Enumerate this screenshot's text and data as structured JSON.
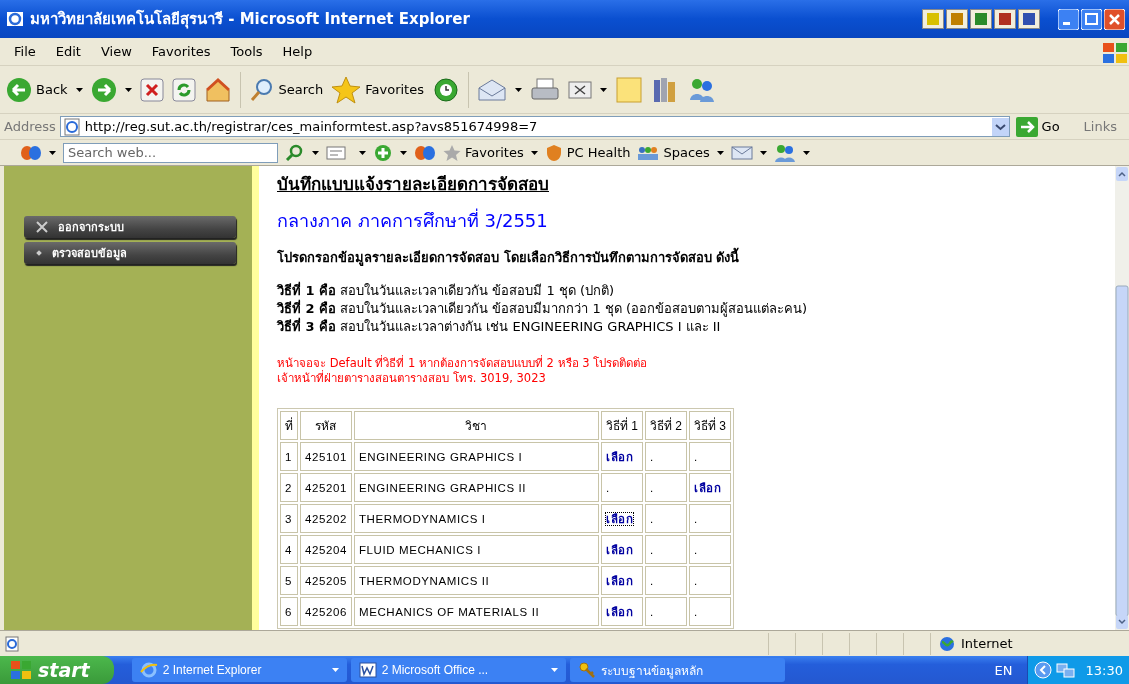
{
  "window": {
    "title": "มหาวิทยาลัยเทคโนโลยีสุรนารี - Microsoft Internet Explorer"
  },
  "menu": [
    "File",
    "Edit",
    "View",
    "Favorites",
    "Tools",
    "Help"
  ],
  "toolbar": {
    "back": "Back",
    "search": "Search",
    "favorites": "Favorites"
  },
  "address": {
    "label": "Address",
    "url": "http://reg.sut.ac.th/registrar/ces_mainformtest.asp?avs851674998=7",
    "go": "Go",
    "links": "Links"
  },
  "search_bar": {
    "placeholder": "Search web...",
    "favorites": "Favorites",
    "pc_health": "PC Health",
    "spaces": "Spaces"
  },
  "sidebar": {
    "items": [
      {
        "label": "ออกจากระบบ",
        "kind": "close"
      },
      {
        "label": "ตรวจสอบข้อมูล",
        "kind": "bullet"
      }
    ]
  },
  "page": {
    "heading": "บันทึกแบบแจ้งรายละเอียดการจัดสอบ",
    "term": "กลางภาค ภาคการศึกษาที่ 3/2551",
    "instruction": "โปรดกรอกข้อมูลรายละเอียดการจัดสอบ โดยเลือกวิธีการบันทึกตามการจัดสอบ ดังนี้",
    "methods": [
      "**วิธีที่ 1 คือ** สอบในวันและเวลาเดียวกัน ข้อสอบมี 1 ชุด (ปกติ)",
      "**วิธีที่ 2 คือ** สอบในวันและเวลาเดียวกัน ข้อสอบมีมากกว่า 1 ชุด (ออกข้อสอบตามผู้สอนแต่ละคน)",
      "**วิธีที่ 3 คือ** สอบในวันและเวลาต่างกัน เช่น ENGINEERING GRAPHICS I และ II"
    ],
    "note": [
      "หน้าจอจะ Default ที่วิธีที่ 1 หากต้องการจัดสอบแบบที่ 2 หรือ 3 โปรดติดต่อ",
      "เจ้าหน้าที่ฝ่ายตารางสอนตารางสอบ โทร. 3019, 3023"
    ]
  },
  "table": {
    "columns": [
      "ที่",
      "รหัส",
      "วิชา",
      "วิธีที่ 1",
      "วิธีที่ 2",
      "วิธีที่ 3"
    ],
    "rows": [
      {
        "cells": [
          "1",
          "425101",
          "ENGINEERING GRAPHICS I"
        ],
        "choices": [
          {
            "text": "เลือก",
            "link": true,
            "focused": false
          },
          {
            "text": ".",
            "link": false,
            "focused": false
          },
          {
            "text": ".",
            "link": false,
            "focused": false
          }
        ]
      },
      {
        "cells": [
          "2",
          "425201",
          "ENGINEERING GRAPHICS II"
        ],
        "choices": [
          {
            "text": ".",
            "link": false,
            "focused": false
          },
          {
            "text": ".",
            "link": false,
            "focused": false
          },
          {
            "text": "เลือก",
            "link": true,
            "focused": false
          }
        ]
      },
      {
        "cells": [
          "3",
          "425202",
          "THERMODYNAMICS I"
        ],
        "choices": [
          {
            "text": "เลือก",
            "link": true,
            "focused": true
          },
          {
            "text": ".",
            "link": false,
            "focused": false
          },
          {
            "text": ".",
            "link": false,
            "focused": false
          }
        ]
      },
      {
        "cells": [
          "4",
          "425204",
          "FLUID MECHANICS I"
        ],
        "choices": [
          {
            "text": "เลือก",
            "link": true,
            "focused": false
          },
          {
            "text": ".",
            "link": false,
            "focused": false
          },
          {
            "text": ".",
            "link": false,
            "focused": false
          }
        ]
      },
      {
        "cells": [
          "5",
          "425205",
          "THERMODYNAMICS II"
        ],
        "choices": [
          {
            "text": "เลือก",
            "link": true,
            "focused": false
          },
          {
            "text": ".",
            "link": false,
            "focused": false
          },
          {
            "text": ".",
            "link": false,
            "focused": false
          }
        ]
      },
      {
        "cells": [
          "6",
          "425206",
          "MECHANICS OF MATERIALS II"
        ],
        "choices": [
          {
            "text": "เลือก",
            "link": true,
            "focused": false
          },
          {
            "text": ".",
            "link": false,
            "focused": false
          },
          {
            "text": ".",
            "link": false,
            "focused": false
          }
        ]
      }
    ]
  },
  "status_bar": {
    "zone": "Internet"
  },
  "taskbar": {
    "start": "start",
    "tasks": [
      {
        "label": "2 Internet Explorer",
        "kind": "ie",
        "grouped": true
      },
      {
        "label": "2 Microsoft Office ...",
        "kind": "word",
        "grouped": true
      },
      {
        "label": "ระบบฐานข้อมูลหลัก",
        "kind": "keys",
        "grouped": false
      }
    ],
    "language": "EN",
    "clock": "13:30"
  }
}
